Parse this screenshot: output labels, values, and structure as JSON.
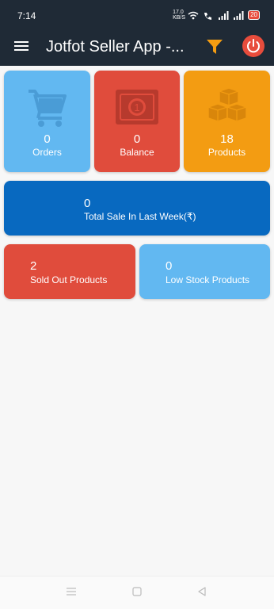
{
  "status_bar": {
    "time": "7:14",
    "speed": "17.0 KB/S",
    "battery": "20"
  },
  "app_bar": {
    "title": "Jotfot Seller App -...",
    "menu_icon": "hamburger-menu-icon",
    "filter_icon": "filter-icon",
    "power_icon": "power-icon"
  },
  "cards": {
    "orders": {
      "value": "0",
      "label": "Orders",
      "color": "#62b8f1",
      "icon": "cart-icon"
    },
    "balance": {
      "value": "0",
      "label": "Balance",
      "color": "#e04c3c",
      "icon": "banknote-icon"
    },
    "products": {
      "value": "18",
      "label": "Products",
      "color": "#f39c12",
      "icon": "boxes-icon"
    },
    "weekly_sale": {
      "value": "0",
      "label": "Total Sale In Last Week(₹)",
      "color": "#0869c0"
    },
    "sold_out": {
      "value": "2",
      "label": "Sold Out Products",
      "color": "#e04c3c"
    },
    "low_stock": {
      "value": "0",
      "label": "Low Stock Products",
      "color": "#62b8f1"
    }
  },
  "nav_bar": {
    "recent_icon": "recent-apps-icon",
    "home_icon": "home-icon",
    "back_icon": "back-icon"
  }
}
